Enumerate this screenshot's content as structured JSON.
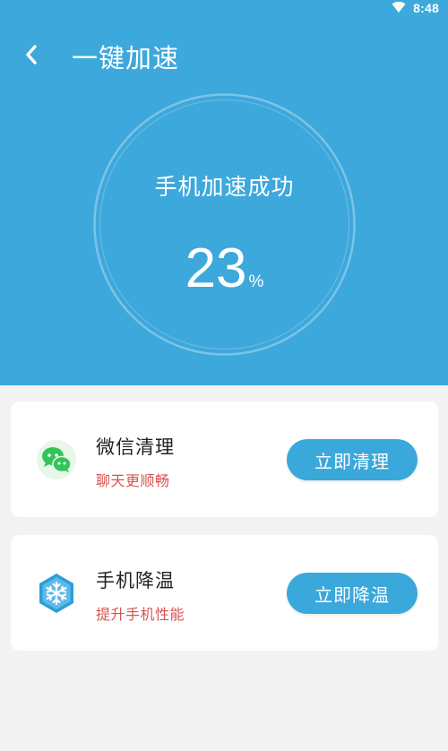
{
  "status_bar": {
    "time": "8:48",
    "wifi_icon": "wifi-icon"
  },
  "header": {
    "back_icon": "chevron-left-icon",
    "title": "一键加速",
    "background_color": "#3da8db"
  },
  "result": {
    "status_text": "手机加速成功",
    "percent_value": "23",
    "percent_unit": "%"
  },
  "cards": [
    {
      "title": "微信清理",
      "subtitle": "聊天更顺畅",
      "button_label": "立即清理",
      "icon": "wechat-icon"
    },
    {
      "title": "手机降温",
      "subtitle": "提升手机性能",
      "button_label": "立即降温",
      "icon": "snowflake-icon"
    }
  ],
  "colors": {
    "accent": "#3aa8da",
    "subtitle": "#d9534f",
    "wechat": "#33c45a"
  }
}
